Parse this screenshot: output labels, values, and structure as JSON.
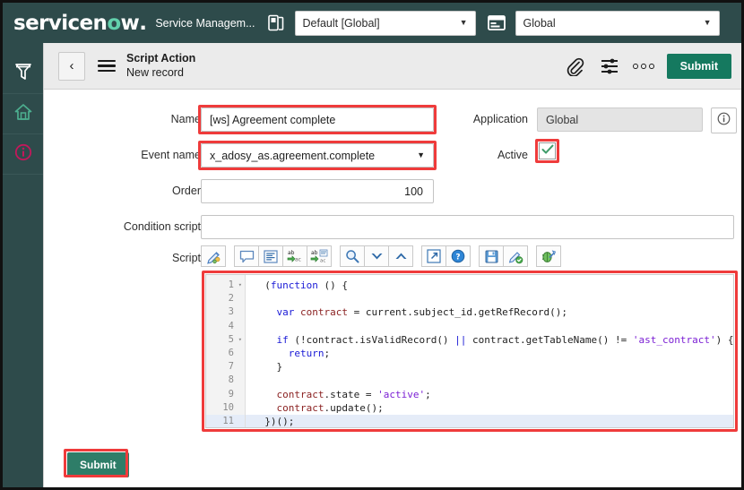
{
  "topbar": {
    "logo_text_1": "servicen",
    "logo_o": "o",
    "logo_text_2": "w",
    "logo_dot": ".",
    "service_management": "Service Managem...",
    "update_set_icon": "update-set-icon",
    "update_set_value": "Default [Global]",
    "app_scope_icon": "application-scope-icon",
    "app_scope_value": "Global",
    "caret": "▼",
    "background": "#2e4b4b"
  },
  "sidebar": {
    "items": [
      {
        "name": "filter-navigator-icon",
        "label": "Filter navigator",
        "color": "#ffffff"
      },
      {
        "name": "home-icon",
        "label": "Home",
        "color": "#4cae8f"
      },
      {
        "name": "info-icon",
        "label": "Information",
        "color": "#c2185b"
      }
    ]
  },
  "form_header": {
    "back_label": "‹",
    "menu_icon": "hamburger-menu-icon",
    "title": "Script Action",
    "subtitle": "New record",
    "attachment_icon": "paperclip-icon",
    "personalize_icon": "sliders-icon",
    "more_icon": "more-options-icon",
    "submit_label": "Submit"
  },
  "form": {
    "name_label": "Name",
    "name_value": "[ws] Agreement complete",
    "event_name_label": "Event name",
    "event_name_value": "x_adosy_as.agreement.complete",
    "order_label": "Order",
    "order_value": "100",
    "condition_script_label": "Condition script",
    "condition_script_value": "",
    "application_label": "Application",
    "application_value": "Global",
    "application_info_icon": "info-circle-icon",
    "active_label": "Active",
    "active_checked": "✓",
    "script_label": "Script",
    "highlight_color": "#ef3b3b"
  },
  "script_toolbar": {
    "groups": [
      [
        {
          "name": "script-editor-icon",
          "label": "Toggle script editor"
        }
      ],
      [
        {
          "name": "comment-icon",
          "label": "Comment"
        },
        {
          "name": "format-code-icon",
          "label": "Format code"
        },
        {
          "name": "replace-icon",
          "label": "Replace"
        },
        {
          "name": "replace-all-icon",
          "label": "Replace all"
        }
      ],
      [
        {
          "name": "search-icon",
          "label": "Find"
        },
        {
          "name": "find-next-icon",
          "label": "Find next"
        },
        {
          "name": "find-previous-icon",
          "label": "Find previous"
        }
      ],
      [
        {
          "name": "fullscreen-icon",
          "label": "Toggle fullscreen"
        },
        {
          "name": "help-icon",
          "label": "Help"
        }
      ],
      [
        {
          "name": "save-icon",
          "label": "Save"
        },
        {
          "name": "syntax-check-icon",
          "label": "Syntax check"
        }
      ],
      [
        {
          "name": "debug-icon",
          "label": "Debug script"
        }
      ]
    ]
  },
  "editor": {
    "lines": [
      {
        "number": "1",
        "fold": "▾",
        "tokens": [
          {
            "t": "  (",
            "c": "plain"
          },
          {
            "t": "function",
            "c": "kw"
          },
          {
            "t": " () {",
            "c": "plain"
          }
        ]
      },
      {
        "number": "2",
        "fold": "",
        "tokens": []
      },
      {
        "number": "3",
        "fold": "",
        "tokens": [
          {
            "t": "    ",
            "c": "plain"
          },
          {
            "t": "var",
            "c": "kw"
          },
          {
            "t": " ",
            "c": "plain"
          },
          {
            "t": "contract",
            "c": "var"
          },
          {
            "t": " = current.subject_id.getRefRecord();",
            "c": "plain"
          }
        ]
      },
      {
        "number": "4",
        "fold": "",
        "tokens": []
      },
      {
        "number": "5",
        "fold": "▾",
        "tokens": [
          {
            "t": "    ",
            "c": "plain"
          },
          {
            "t": "if",
            "c": "kw"
          },
          {
            "t": " (!contract.isValidRecord() ",
            "c": "plain"
          },
          {
            "t": "||",
            "c": "kw"
          },
          {
            "t": " contract.getTableName() != ",
            "c": "plain"
          },
          {
            "t": "'ast_contract'",
            "c": "str"
          },
          {
            "t": ") {",
            "c": "plain"
          }
        ]
      },
      {
        "number": "6",
        "fold": "",
        "tokens": [
          {
            "t": "      ",
            "c": "plain"
          },
          {
            "t": "return",
            "c": "kw"
          },
          {
            "t": ";",
            "c": "plain"
          }
        ]
      },
      {
        "number": "7",
        "fold": "",
        "tokens": [
          {
            "t": "    }",
            "c": "plain"
          }
        ]
      },
      {
        "number": "8",
        "fold": "",
        "tokens": []
      },
      {
        "number": "9",
        "fold": "",
        "tokens": [
          {
            "t": "    ",
            "c": "plain"
          },
          {
            "t": "contract",
            "c": "var"
          },
          {
            "t": ".state = ",
            "c": "plain"
          },
          {
            "t": "'active'",
            "c": "str"
          },
          {
            "t": ";",
            "c": "plain"
          }
        ]
      },
      {
        "number": "10",
        "fold": "",
        "tokens": [
          {
            "t": "    ",
            "c": "plain"
          },
          {
            "t": "contract",
            "c": "var"
          },
          {
            "t": ".update();",
            "c": "plain"
          }
        ]
      },
      {
        "number": "11",
        "fold": "",
        "active": true,
        "tokens": [
          {
            "t": "  })();",
            "c": "plain"
          }
        ]
      }
    ]
  },
  "footer": {
    "submit_label": "Submit"
  }
}
